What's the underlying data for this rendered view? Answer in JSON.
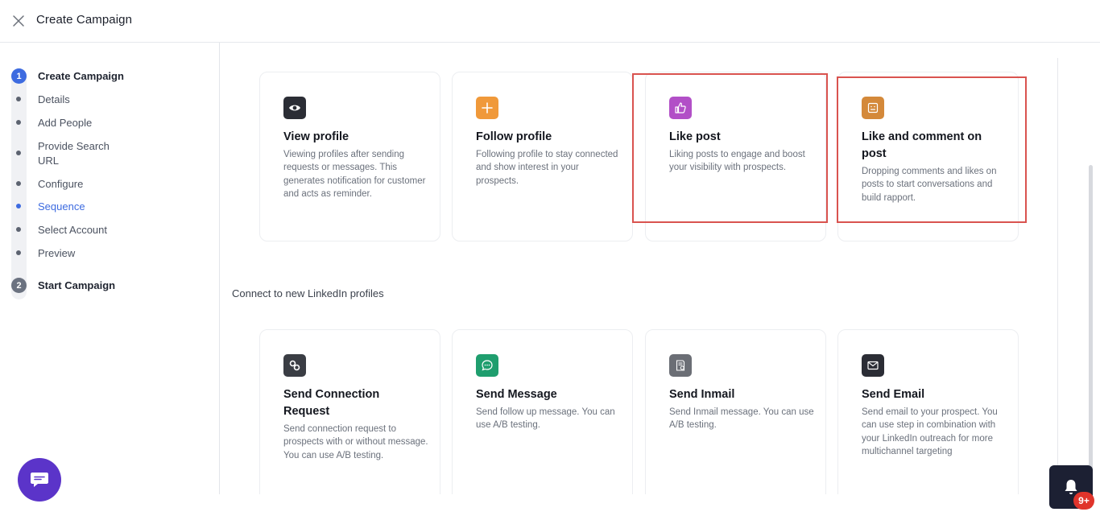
{
  "header": {
    "title": "Create Campaign"
  },
  "sidebar": {
    "steps": [
      {
        "number": "1",
        "label": "Create Campaign"
      },
      {
        "number": "2",
        "label": "Start Campaign"
      }
    ],
    "items": [
      {
        "label": "Details"
      },
      {
        "label": "Add People"
      },
      {
        "label": "Provide Search URL"
      },
      {
        "label": "Configure"
      },
      {
        "label": "Sequence"
      },
      {
        "label": "Select Account"
      },
      {
        "label": "Preview"
      }
    ],
    "current_item": "Sequence"
  },
  "engage_cards": [
    {
      "icon": "eye-icon",
      "color": "#2b2d35",
      "title": "View profile",
      "description": "Viewing profiles after sending requests or messages. This generates notification for customer and acts as reminder."
    },
    {
      "icon": "plus-icon",
      "color": "#f0993a",
      "title": "Follow profile",
      "description": "Following profile to stay connected and show interest in your prospects."
    },
    {
      "icon": "thumbs-up-icon",
      "color": "#b24fc7",
      "title": "Like post",
      "description": "Liking posts to engage and boost your visibility with prospects."
    },
    {
      "icon": "smiley-icon",
      "color": "#d4893a",
      "title": "Like and comment on post",
      "description": "Dropping comments and likes on posts to start conversations and build rapport."
    }
  ],
  "section_connect": {
    "label": "Connect to new LinkedIn profiles"
  },
  "connect_cards": [
    {
      "icon": "link-icon",
      "color": "#3a3d44",
      "title": "Send Connection Request",
      "description": "Send connection request to prospects with or without message. You can use A/B testing."
    },
    {
      "icon": "chat-icon",
      "color": "#1f9e6e",
      "title": "Send Message",
      "description": "Send follow up message. You can use A/B testing."
    },
    {
      "icon": "inmail-icon",
      "color": "#6b6e75",
      "title": "Send Inmail",
      "description": "Send Inmail message. You can use A/B testing."
    },
    {
      "icon": "mail-icon",
      "color": "#2b2d35",
      "title": "Send Email",
      "description": "Send email to your prospect. You can use step in combination with your LinkedIn outreach for more multichannel targeting"
    }
  ],
  "notifications": {
    "badge": "9+"
  },
  "colors": {
    "accent": "#3d6be0",
    "highlight": "#d9534f",
    "chat_fab": "#5b34c9"
  }
}
